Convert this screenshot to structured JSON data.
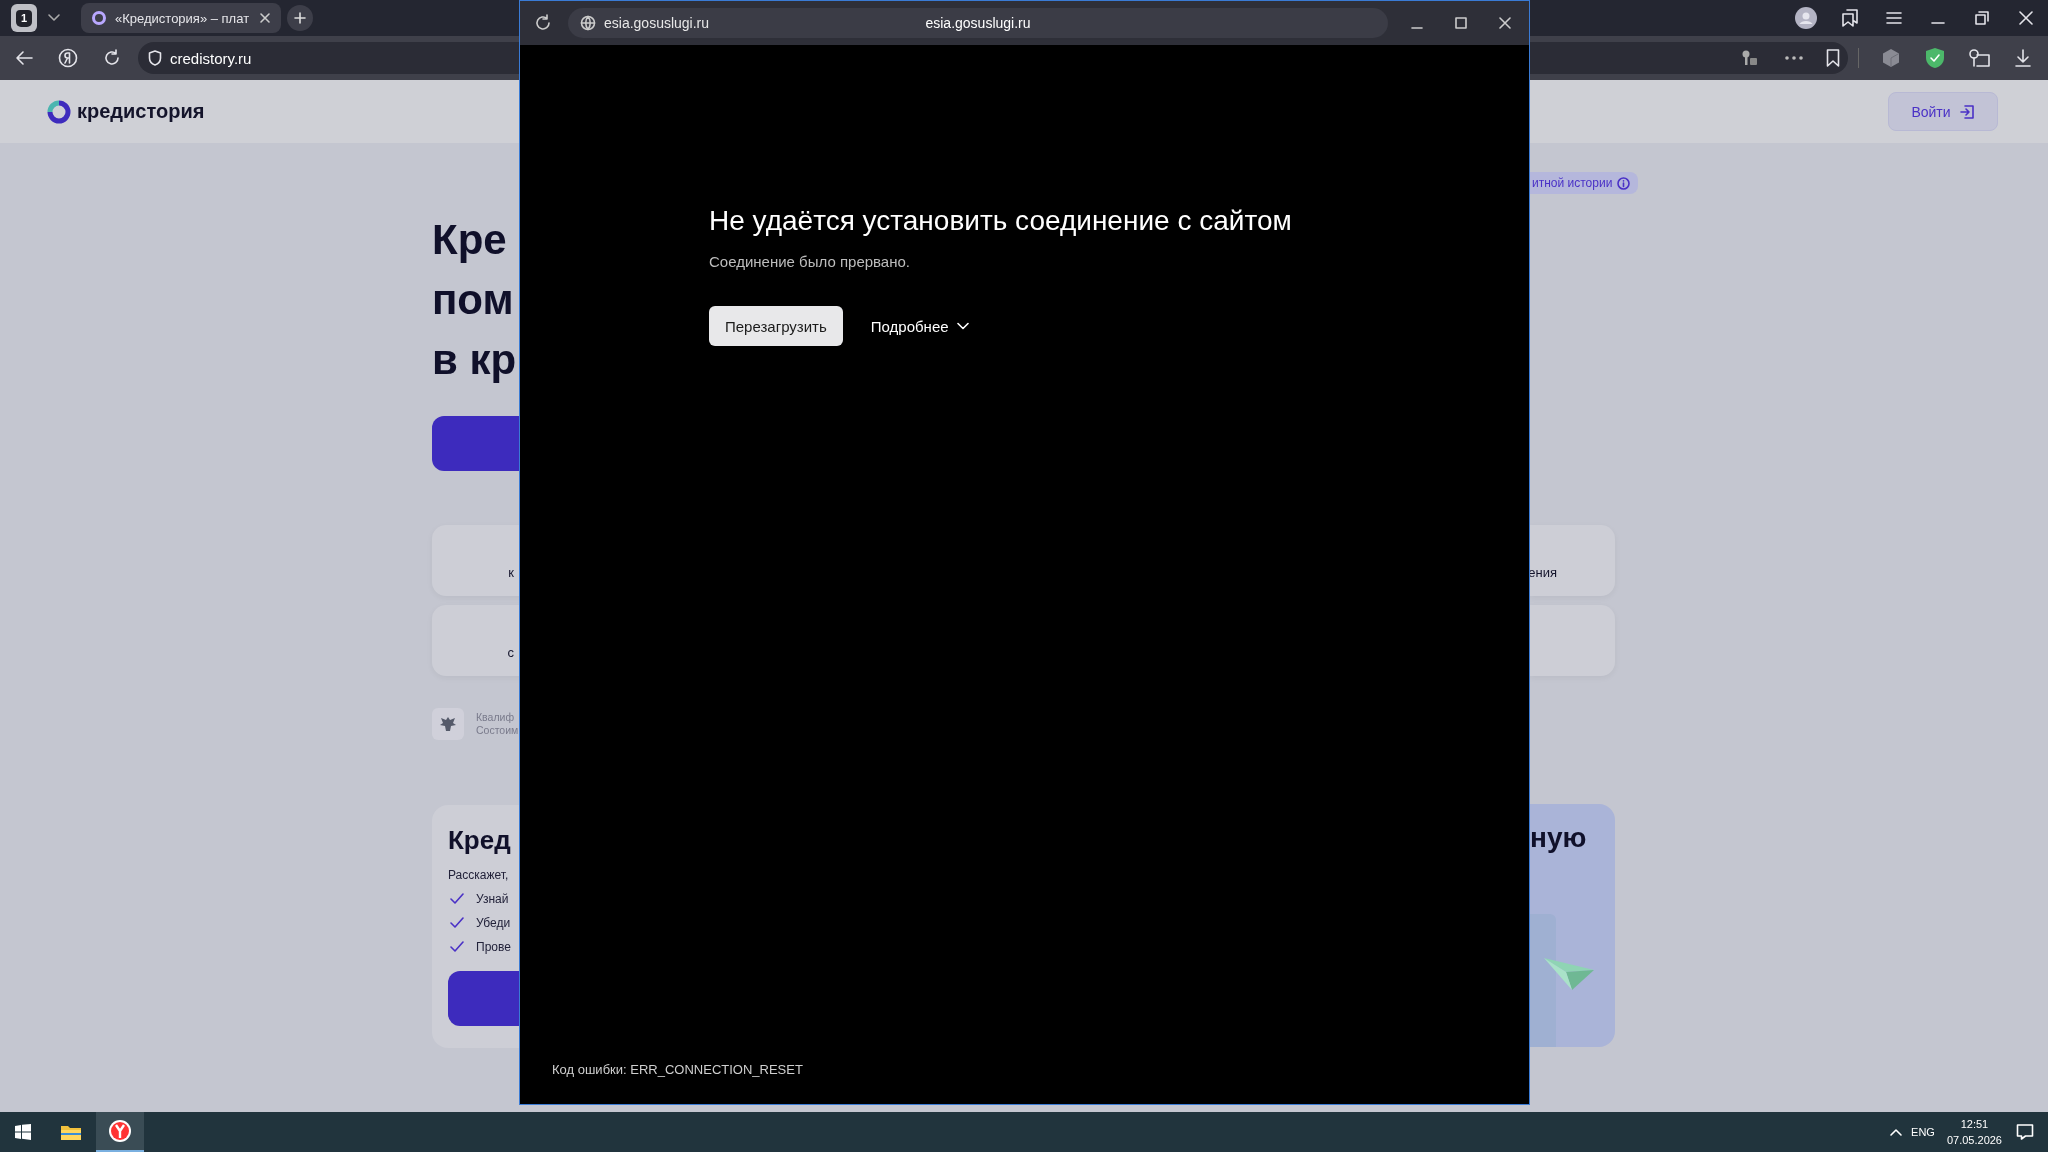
{
  "browser": {
    "tab_counter": "1",
    "tabs": [
      {
        "title": "«Кредистория» – плат",
        "selected": true
      }
    ],
    "address": "credistory.ru"
  },
  "page": {
    "logo": "кредистория",
    "login_button": "Войти",
    "badge": "итной истории",
    "hero_lines": [
      "Кре",
      "пом",
      "в кр"
    ],
    "cards": [
      {
        "left": "к",
        "right": "ения"
      },
      {
        "left": "с"
      }
    ],
    "license_lines": [
      "Квалиф",
      "Состоим"
    ],
    "promo": {
      "title_left": "Кред",
      "title_right": "ную",
      "text": "Расскажет,",
      "checks": [
        "Узнай",
        "Убеди",
        "Прове"
      ]
    }
  },
  "popup": {
    "address": "esia.gosuslugi.ru",
    "title": "esia.gosuslugi.ru",
    "heading": "Не удаётся установить соединение с сайтом",
    "message": "Соединение было прервано.",
    "reload_button": "Перезагрузить",
    "details_button": "Подробнее",
    "error_code": "Код ошибки: ERR_CONNECTION_RESET"
  },
  "taskbar": {
    "apps": [
      {
        "kind": "explorer",
        "selected": false
      },
      {
        "kind": "browser",
        "selected": true
      }
    ],
    "language": "ENG",
    "time": "12:51",
    "date": "07.05.2026"
  }
}
